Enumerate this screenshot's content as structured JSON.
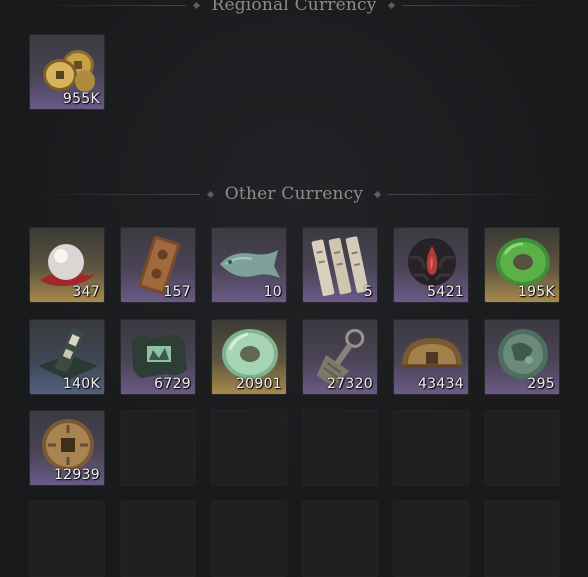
{
  "sections": {
    "regional": {
      "title": "Regional Currency"
    },
    "other": {
      "title": "Other Currency"
    }
  },
  "regional_items": [
    {
      "icon": "gold-coins-icon",
      "count": "955K"
    }
  ],
  "other_items": [
    {
      "icon": "pearl-icon",
      "count": "347"
    },
    {
      "icon": "bronze-token-icon",
      "count": "157"
    },
    {
      "icon": "jade-fish-icon",
      "count": "10"
    },
    {
      "icon": "scroll-slips-icon",
      "count": "5"
    },
    {
      "icon": "dark-flame-emblem-icon",
      "count": "5421"
    },
    {
      "icon": "green-jade-ring-icon",
      "count": "195K"
    },
    {
      "icon": "jade-tablet-icon",
      "count": "140K"
    },
    {
      "icon": "jade-map-icon",
      "count": "6729"
    },
    {
      "icon": "pale-jade-disc-icon",
      "count": "20901"
    },
    {
      "icon": "spade-coin-icon",
      "count": "27320"
    },
    {
      "icon": "bronze-half-disc-icon",
      "count": "43434"
    },
    {
      "icon": "patina-coin-icon",
      "count": "295"
    },
    {
      "icon": "square-hole-coin-icon",
      "count": "12939"
    }
  ],
  "colors": {
    "background": "#191a1c",
    "header_text": "#8c8c88",
    "count_text": "#f0f0ec",
    "purple_rarity": "#6a5a86",
    "gold_rarity": "#a88a4a",
    "blue_rarity": "#52607c"
  }
}
